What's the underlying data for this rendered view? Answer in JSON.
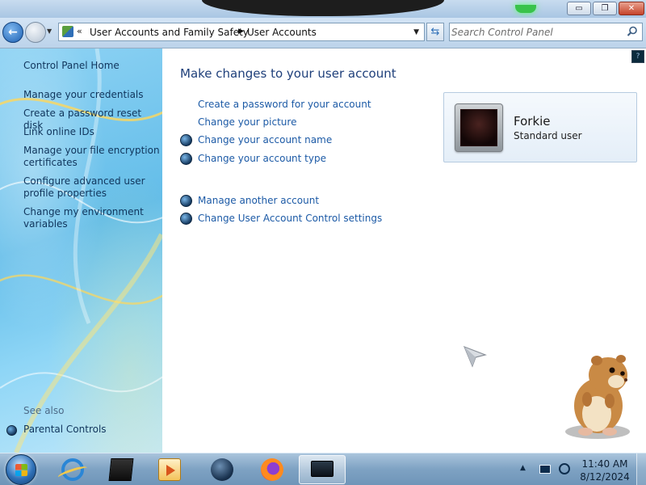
{
  "window": {
    "minimize_glyph": "▭",
    "maximize_glyph": "❐",
    "close_glyph": "✕"
  },
  "address_bar": {
    "overflow": "«",
    "crumbs": [
      "User Accounts and Family Safety",
      "User Accounts"
    ],
    "search_placeholder": "Search Control Panel"
  },
  "sidebar": {
    "home": "Control Panel Home",
    "links": [
      "Manage your credentials",
      "Create a password reset disk",
      "Link online IDs",
      "Manage your file encryption certificates",
      "Configure advanced user profile properties",
      "Change my environment variables"
    ],
    "see_also_label": "See also",
    "see_also_items": [
      "Parental Controls"
    ]
  },
  "main": {
    "title": "Make changes to your user account",
    "tasks": [
      "Create a password for your account",
      "Change your picture",
      "Change your account name",
      "Change your account type"
    ],
    "other_tasks": [
      "Manage another account",
      "Change User Account Control settings"
    ],
    "user": {
      "name": "Forkie",
      "role": "Standard user"
    }
  },
  "taskbar": {
    "apps": [
      "start-orb",
      "internet-explorer-icon",
      "3d-box-app-icon",
      "media-player-icon",
      "globe-app-icon",
      "firefox-icon",
      "display-app-icon"
    ],
    "time": "11:40 AM",
    "date": "8/12/2024"
  },
  "colors": {
    "link": "#1c5aa6",
    "title": "#1e3f7a",
    "sidebar_text": "#10355c"
  }
}
